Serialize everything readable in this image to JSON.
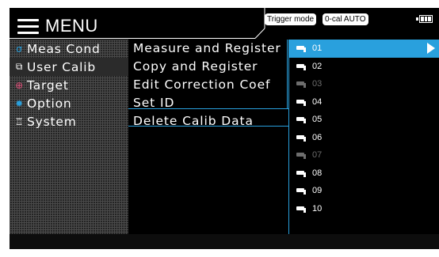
{
  "header": {
    "menu_label": "MENU",
    "trigger_mode": "Trigger mode",
    "zero_cal": "0-cal AUTO",
    "battery_icon": "battery-icon"
  },
  "left_menu": {
    "items": [
      {
        "label": "Meas Cond",
        "icon": "meas-cond-icon",
        "icon_color": "#29a0dd",
        "glyph": "σ"
      },
      {
        "label": "User Calib",
        "icon": "user-calib-icon",
        "icon_color": "#ffffff",
        "glyph": "⧉"
      },
      {
        "label": "Target",
        "icon": "target-icon",
        "icon_color": "#e0507a",
        "glyph": "⊕"
      },
      {
        "label": "Option",
        "icon": "option-gear-icon",
        "icon_color": "#29a0dd",
        "glyph": "✹"
      },
      {
        "label": "System",
        "icon": "system-tools-icon",
        "icon_color": "#ffffff",
        "glyph": "♖"
      }
    ],
    "selected": "User Calib"
  },
  "sub_menu": {
    "items": [
      "Measure and Register",
      "Copy and Register",
      "Edit Correction Coef",
      "Set ID",
      "Delete Calib Data"
    ]
  },
  "calib_list": {
    "items": [
      {
        "label": "01",
        "state": "selected"
      },
      {
        "label": "02",
        "state": "normal"
      },
      {
        "label": "03",
        "state": "dim"
      },
      {
        "label": "04",
        "state": "normal"
      },
      {
        "label": "05",
        "state": "normal"
      },
      {
        "label": "06",
        "state": "normal"
      },
      {
        "label": "07",
        "state": "dim"
      },
      {
        "label": "08",
        "state": "normal"
      },
      {
        "label": "09",
        "state": "normal"
      },
      {
        "label": "10",
        "state": "normal"
      }
    ]
  },
  "colors": {
    "accent": "#29a0dd",
    "background": "#000000",
    "dim_text": "#6d6d6d"
  }
}
